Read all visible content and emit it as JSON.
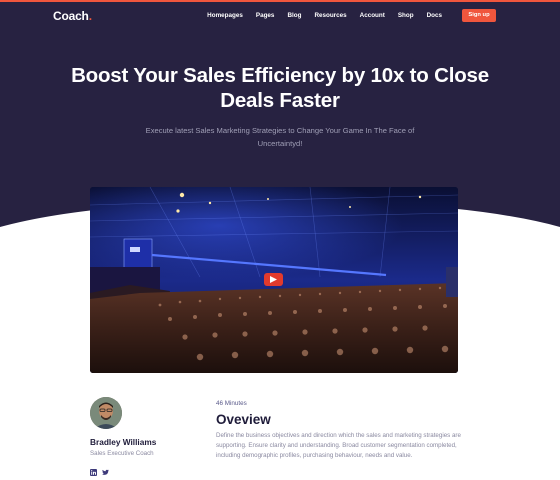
{
  "header": {
    "logo_text": "Coach",
    "logo_dot": ".",
    "menu": [
      "Homepages",
      "Pages",
      "Blog",
      "Resources",
      "Account",
      "Shop",
      "Docs"
    ],
    "signup_label": "Sign up"
  },
  "hero": {
    "headline": "Boost Your Sales Efficiency by 10x to Close Deals Faster",
    "subtitle": "Execute latest Sales Marketing Strategies to Change Your Game In The Face of Uncertaintyd!"
  },
  "video": {
    "play_icon": "play-icon"
  },
  "author": {
    "name": "Bradley Williams",
    "role": "Sales Executive Coach",
    "socials": [
      "linkedin-icon",
      "twitter-icon"
    ]
  },
  "overview": {
    "duration": "46 Minutes",
    "title": "Oveview",
    "description": "Define the business objectives and direction which the sales and marketing strategies are supporting. Ensure clarity and understanding. Broad customer segmentation completed, including demographic profiles, purchasing behaviour, needs and value."
  },
  "colors": {
    "hero_bg": "#272241",
    "accent": "#f0563d",
    "heading_text": "#1f1c3a",
    "muted_text": "#8a89a0"
  }
}
